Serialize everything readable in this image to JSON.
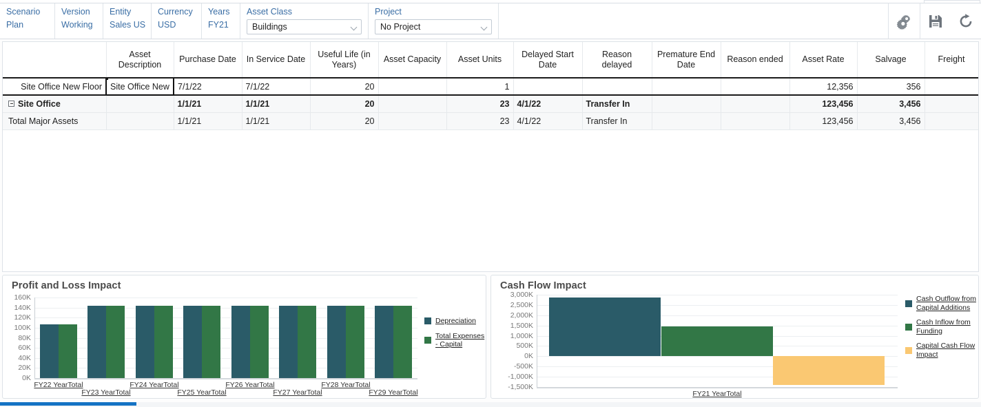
{
  "pov": {
    "items": [
      {
        "label": "Scenario",
        "value": "Plan",
        "type": "text"
      },
      {
        "label": "Version",
        "value": "Working",
        "type": "text"
      },
      {
        "label": "Entity",
        "value": "Sales US",
        "type": "text"
      },
      {
        "label": "Currency",
        "value": "USD",
        "type": "text"
      },
      {
        "label": "Years",
        "value": "FY21",
        "type": "text"
      },
      {
        "label": "Asset Class",
        "value": "Buildings",
        "type": "select"
      },
      {
        "label": "Project",
        "value": "No Project",
        "type": "select"
      }
    ],
    "icons": [
      {
        "name": "settings-gear-icon"
      },
      {
        "name": "save-icon"
      },
      {
        "name": "refresh-icon"
      }
    ]
  },
  "grid": {
    "columns": [
      "Asset Description",
      "Purchase Date",
      "In Service Date",
      "Useful Life (in Years)",
      "Asset Capacity",
      "Asset Units",
      "Delayed Start Date",
      "Reason delayed",
      "Premature End Date",
      "Reason ended",
      "Asset Rate",
      "Salvage",
      "Freight"
    ],
    "rows": [
      {
        "header": "Site Office New Floor",
        "style": "asset",
        "expandable": false,
        "cells": [
          "Site Office New",
          "7/1/22",
          "7/1/22",
          "20",
          "",
          "1",
          "",
          "",
          "",
          "",
          "12,356",
          "356",
          ""
        ]
      },
      {
        "header": "Site Office",
        "style": "parent",
        "expandable": true,
        "cells": [
          "",
          "1/1/21",
          "1/1/21",
          "20",
          "",
          "23",
          "4/1/22",
          "Transfer In",
          "",
          "",
          "123,456",
          "3,456",
          ""
        ]
      },
      {
        "header": "Total Major Assets",
        "style": "total",
        "expandable": false,
        "cells": [
          "",
          "1/1/21",
          "1/1/21",
          "20",
          "",
          "23",
          "4/1/22",
          "Transfer In",
          "",
          "",
          "123,456",
          "3,456",
          ""
        ]
      }
    ]
  },
  "chart_data": [
    {
      "id": "profit-loss-impact",
      "type": "bar",
      "title": "Profit and Loss Impact",
      "xlabel": "",
      "ylabel": "",
      "ylim": [
        0,
        160000
      ],
      "ytick_labels": [
        "160K",
        "140K",
        "120K",
        "100K",
        "80K",
        "60K",
        "40K",
        "20K",
        "0K"
      ],
      "ytick_values": [
        160000,
        140000,
        120000,
        100000,
        80000,
        60000,
        40000,
        20000,
        0
      ],
      "grid": true,
      "legend_position": "right",
      "categories": [
        "FY22 YearTotal",
        "FY23 YearTotal",
        "FY24 YearTotal",
        "FY25 YearTotal",
        "FY26 YearTotal",
        "FY27 YearTotal",
        "FY28 YearTotal",
        "FY29 YearTotal"
      ],
      "series": [
        {
          "name": "Depreciation",
          "color": "#2a5b68",
          "values": [
            107000,
            143000,
            143000,
            143000,
            143000,
            143000,
            143000,
            143000
          ]
        },
        {
          "name": "Total Expenses - Capital",
          "color": "#327746",
          "values": [
            107000,
            143000,
            143000,
            143000,
            143000,
            143000,
            143000,
            143000
          ]
        }
      ]
    },
    {
      "id": "cash-flow-impact",
      "type": "bar",
      "title": "Cash Flow Impact",
      "xlabel": "",
      "ylabel": "",
      "ylim": [
        -1500000,
        3000000
      ],
      "ytick_labels": [
        "3,000K",
        "2,500K",
        "2,000K",
        "1,500K",
        "1,000K",
        "500K",
        "0K",
        "-500K",
        "-1,000K",
        "-1,500K"
      ],
      "ytick_values": [
        3000000,
        2500000,
        2000000,
        1500000,
        1000000,
        500000,
        0,
        -500000,
        -1000000,
        -1500000
      ],
      "grid": true,
      "legend_position": "right",
      "categories": [
        "FY21 YearTotal"
      ],
      "series": [
        {
          "name": "Cash Outflow from Capital Additions",
          "color": "#2a5b68",
          "values": [
            2850000
          ]
        },
        {
          "name": "Cash Inflow from Funding",
          "color": "#327746",
          "values": [
            1450000
          ]
        },
        {
          "name": "Capital Cash Flow Impact",
          "color": "#fac872",
          "values": [
            -1400000
          ]
        }
      ]
    }
  ],
  "scrollbar": {
    "name": "horizontal-scrollbar"
  }
}
